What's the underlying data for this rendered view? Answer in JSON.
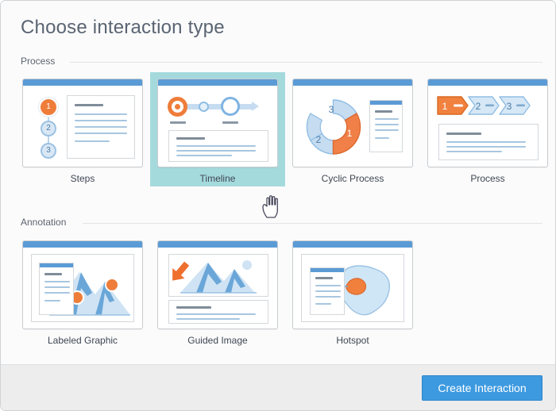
{
  "dialog": {
    "title": "Choose interaction type"
  },
  "sections": [
    {
      "label": "Process"
    },
    {
      "label": "Annotation"
    }
  ],
  "process_cards": [
    {
      "label": "Steps",
      "icon": "steps-icon",
      "selected": false
    },
    {
      "label": "Timeline",
      "icon": "timeline-icon",
      "selected": true
    },
    {
      "label": "Cyclic Process",
      "icon": "cyclic-process-icon",
      "selected": false
    },
    {
      "label": "Process",
      "icon": "process-icon",
      "selected": false
    }
  ],
  "annotation_cards": [
    {
      "label": "Labeled Graphic",
      "icon": "labeled-graphic-icon",
      "selected": false
    },
    {
      "label": "Guided Image",
      "icon": "guided-image-icon",
      "selected": false
    },
    {
      "label": "Hotspot",
      "icon": "hotspot-icon",
      "selected": false
    }
  ],
  "steps_numbers": [
    "1",
    "2",
    "3"
  ],
  "cyclic_numbers": [
    "1",
    "2",
    "3"
  ],
  "process_numbers": [
    "1",
    "2",
    "3"
  ],
  "footer": {
    "primary_button": "Create Interaction"
  },
  "cursor": {
    "icon": "pointing-hand-cursor"
  },
  "colors": {
    "accent_orange": "#ef7d3a",
    "accent_blue": "#5b9bd5",
    "selected_bg": "#a5dadd",
    "button_blue": "#3d9ae0",
    "light_blue": "#c6dcf0"
  }
}
